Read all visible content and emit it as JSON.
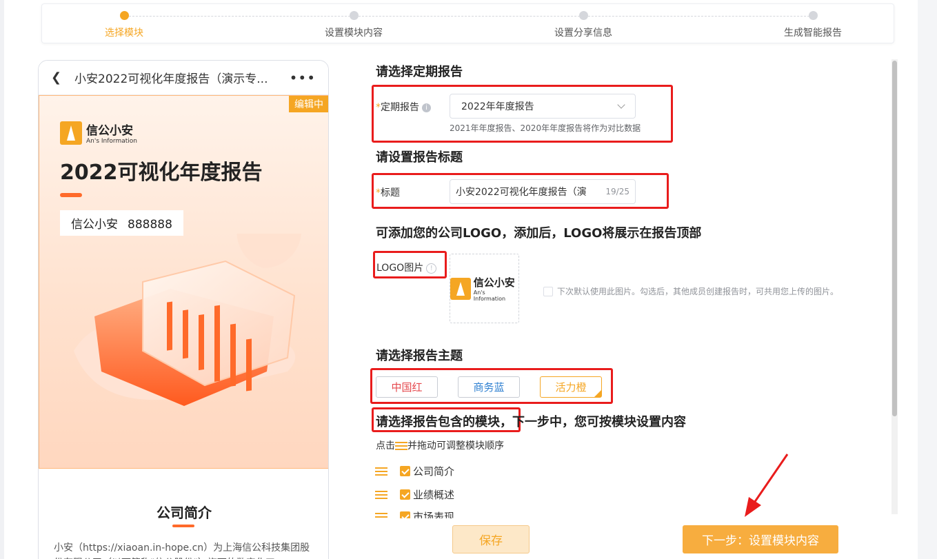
{
  "steps": [
    {
      "label": "选择模块",
      "active": true
    },
    {
      "label": "设置模块内容",
      "active": false
    },
    {
      "label": "设置分享信息",
      "active": false
    },
    {
      "label": "生成智能报告",
      "active": false
    }
  ],
  "preview": {
    "header_title": "小安2022可视化年度报告（演示专...",
    "editing_badge": "编辑中",
    "brand_cn": "信公小安",
    "brand_en": "An's Information",
    "cover_title": "2022可视化年度报告",
    "company_name": "信公小安",
    "company_code": "888888",
    "section_heading": "公司简介",
    "section_text": "小安（https://xiaoan.in-hope.cn）为上海信公科技集团股份有限公司（以下简称\"信公股份\"）旗下的数字化工"
  },
  "form": {
    "periodic": {
      "heading": "请选择定期报告",
      "label": "定期报告",
      "value": "2022年年度报告",
      "hint": "2021年年度报告、2020年年度报告将作为对比数据"
    },
    "title": {
      "heading": "请设置报告标题",
      "label": "标题",
      "value": "小安2022可视化年度报告（演",
      "count": "19/25"
    },
    "logo": {
      "heading": "可添加您的公司LOGO，添加后，LOGO将展示在报告顶部",
      "label": "LOGO图片",
      "checkbox_label": "下次默认使用此图片。勾选后，其他成员创建报告时，可共用您上传的图片。"
    },
    "theme": {
      "heading": "请选择报告主题",
      "options": [
        {
          "label": "中国红",
          "color": "#e5484d"
        },
        {
          "label": "商务蓝",
          "color": "#2f80d1"
        },
        {
          "label": "活力橙",
          "color": "#f5a623"
        }
      ],
      "selected": "活力橙"
    },
    "modules": {
      "heading_highlight": "请选择报告包含的模块",
      "heading_rest": "，下一步中，您可按模块设置内容",
      "instruction_prefix": "点击",
      "instruction_suffix": "并拖动可调整模块顺序",
      "items": [
        "公司简介",
        "业绩概述",
        "市场表现"
      ]
    }
  },
  "buttons": {
    "save": "保存",
    "next": "下一步：设置模块内容"
  },
  "colors": {
    "accent": "#f5a623",
    "annotation_red": "#e91c1c"
  }
}
